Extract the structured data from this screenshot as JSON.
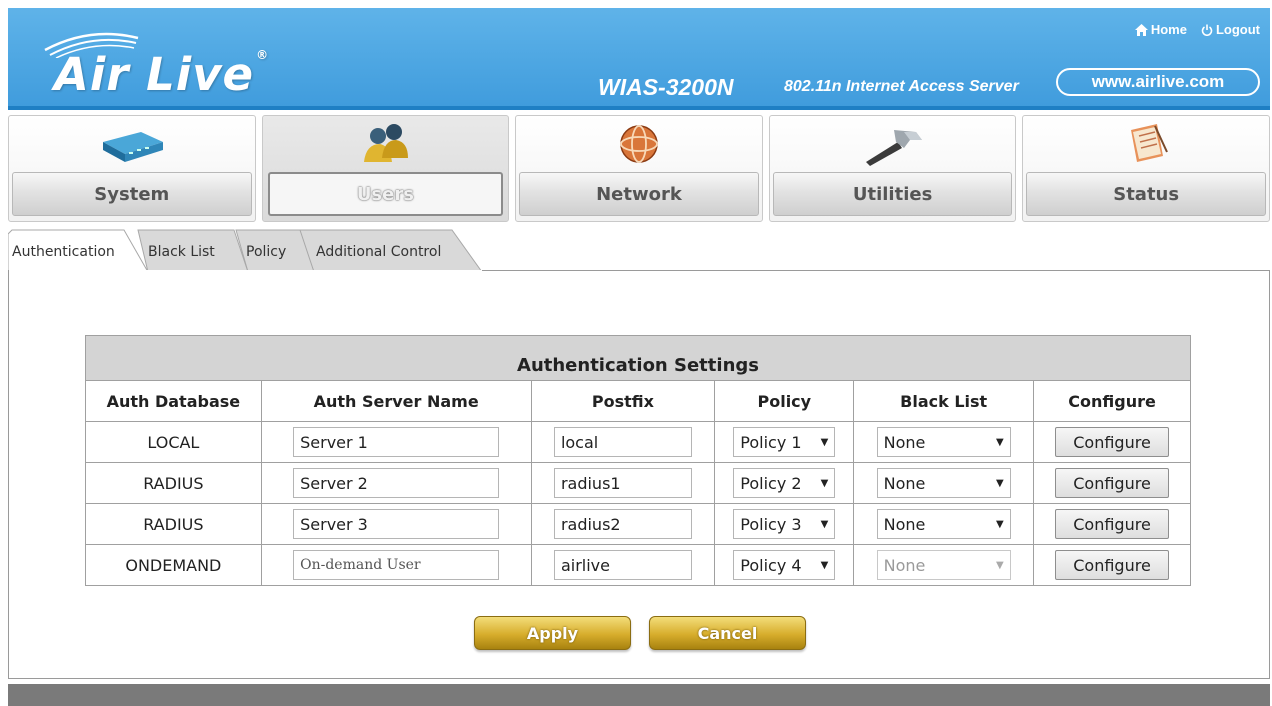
{
  "header": {
    "logo_text": "Air Live",
    "logo_reg": "®",
    "product_name": "WIAS-3200N",
    "product_desc": "802.11n Internet Access Server",
    "website": "www.airlive.com",
    "home_label": "Home",
    "logout_label": "Logout",
    "brand_color": "#4da6e2"
  },
  "nav": {
    "items": [
      {
        "label": "System",
        "icon": "server-device-icon"
      },
      {
        "label": "Users",
        "icon": "users-icon",
        "active": true
      },
      {
        "label": "Network",
        "icon": "network-globe-icon"
      },
      {
        "label": "Utilities",
        "icon": "hammer-icon"
      },
      {
        "label": "Status",
        "icon": "document-status-icon"
      }
    ]
  },
  "tabs": {
    "items": [
      {
        "label": "Authentication",
        "active": true
      },
      {
        "label": "Black List"
      },
      {
        "label": "Policy"
      },
      {
        "label": "Additional Control"
      }
    ]
  },
  "table": {
    "title": "Authentication Settings",
    "headers": [
      "Auth Database",
      "Auth Server Name",
      "Postfix",
      "Policy",
      "Black List",
      "Configure"
    ],
    "rows": [
      {
        "database": "LOCAL",
        "server_name": "Server 1",
        "postfix": "local",
        "policy": "Policy 1",
        "black_list": "None",
        "configure": "Configure"
      },
      {
        "database": "RADIUS",
        "server_name": "Server 2",
        "postfix": "radius1",
        "policy": "Policy 2",
        "black_list": "None",
        "configure": "Configure"
      },
      {
        "database": "RADIUS",
        "server_name": "Server 3",
        "postfix": "radius2",
        "policy": "Policy 3",
        "black_list": "None",
        "configure": "Configure"
      },
      {
        "database": "ONDEMAND",
        "server_name": "On-demand User",
        "postfix": "airlive",
        "policy": "Policy 4",
        "black_list": "None",
        "configure": "Configure",
        "black_list_disabled": true
      }
    ]
  },
  "actions": {
    "apply_label": "Apply",
    "cancel_label": "Cancel",
    "button_color": "#d7ad2c"
  }
}
